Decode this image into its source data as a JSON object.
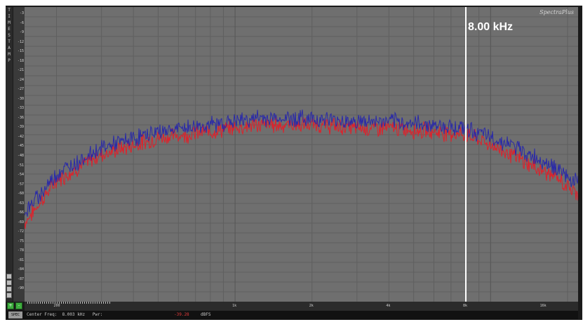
{
  "app": {
    "brand": "SpectraPlus"
  },
  "left_toolbar": {
    "letters": [
      "T",
      "I",
      "M",
      "E",
      "S",
      "T",
      "A",
      "M",
      "P"
    ]
  },
  "y_axis": {
    "labels": [
      "-3",
      "-6",
      "-9",
      "-12",
      "-15",
      "-18",
      "-21",
      "-24",
      "-27",
      "-30",
      "-33",
      "-36",
      "-39",
      "-42",
      "-45",
      "-48",
      "-51",
      "-54",
      "-57",
      "-60",
      "-63",
      "-66",
      "-69",
      "-72",
      "-75",
      "-78",
      "-81",
      "-84",
      "-87",
      "-90"
    ]
  },
  "x_axis": {
    "labels": [
      "200",
      "1k",
      "2k",
      "4k",
      "8k",
      "16k"
    ]
  },
  "marker": {
    "label": "8.00 kHz"
  },
  "status": {
    "icon_text": "SPEC",
    "center_text": "Center Freq:  8.003 kHz   Pwr:",
    "power_value": "-39.28",
    "power_unit": "dBFS"
  },
  "colors": {
    "plot_bg": "#6f6f6f",
    "grid": "#5f5f5f",
    "blue_trace": "#2a2aa8",
    "red_trace": "#e0202a",
    "marker": "#ffffff"
  },
  "chart_data": {
    "type": "line",
    "title": "",
    "xlabel": "",
    "ylabel": "",
    "x_scale": "log",
    "xlim": [
      150,
      22000
    ],
    "ylim": [
      -90,
      0
    ],
    "marker_x": 8000,
    "series": [
      {
        "color": "#2a2aa8",
        "x": [
          150,
          200,
          300,
          500,
          800,
          1200,
          2000,
          3000,
          4000,
          6000,
          8000,
          10000,
          12000,
          14000,
          16000,
          18000,
          20000,
          22000
        ],
        "y": [
          -63,
          -51,
          -43,
          -38,
          -36,
          -34,
          -34,
          -35,
          -35,
          -36,
          -37,
          -40,
          -42,
          -45,
          -47,
          -49,
          -52,
          -54
        ]
      },
      {
        "color": "#e0202a",
        "x": [
          150,
          200,
          300,
          500,
          800,
          1200,
          2000,
          3000,
          4000,
          6000,
          8000,
          10000,
          12000,
          14000,
          16000,
          18000,
          20000,
          22000
        ],
        "y": [
          -66,
          -53,
          -45,
          -40,
          -38,
          -36,
          -36,
          -37,
          -37,
          -38,
          -39,
          -42,
          -45,
          -48,
          -50,
          -52,
          -55,
          -57
        ]
      }
    ]
  }
}
